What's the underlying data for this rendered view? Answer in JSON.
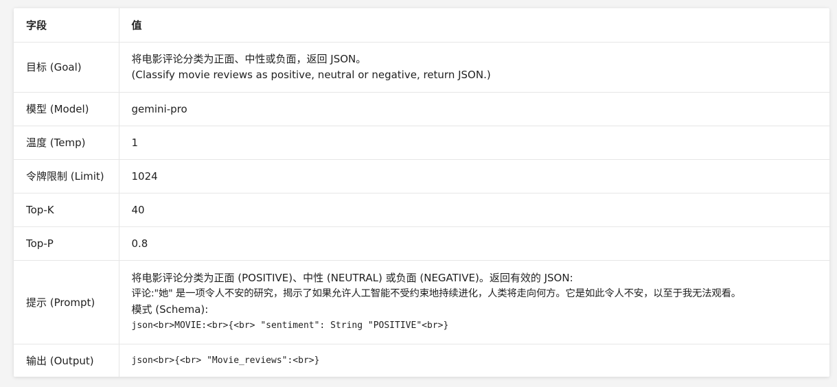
{
  "table": {
    "header": {
      "field": "字段",
      "value": "值"
    },
    "rows": [
      {
        "field": "目标 (Goal)",
        "lines": [
          "将电影评论分类为正面、中性或负面，返回 JSON。",
          "(Classify movie reviews as positive, neutral or negative, return JSON.)"
        ]
      },
      {
        "field": "模型 (Model)",
        "value": "gemini-pro"
      },
      {
        "field": "温度 (Temp)",
        "value": "1"
      },
      {
        "field": "令牌限制 (Limit)",
        "value": "1024"
      },
      {
        "field": "Top-K",
        "value": "40"
      },
      {
        "field": "Top-P",
        "value": "0.8"
      },
      {
        "field": "提示 (Prompt)",
        "lines": [
          "将电影评论分类为正面 (POSITIVE)、中性 (NEUTRAL) 或负面 (NEGATIVE)。返回有效的 JSON:",
          "评论:\"她\" 是一项令人不安的研究，揭示了如果允许人工智能不受约束地持续进化，人类将走向何方。它是如此令人不安，以至于我无法观看。",
          "模式 (Schema):"
        ],
        "code": "json<br>MOVIE:<br>{<br> \"sentiment\": String \"POSITIVE\"<br>}"
      },
      {
        "field": "输出 (Output)",
        "code": "json<br>{<br> \"Movie_reviews\":<br>}"
      }
    ]
  }
}
